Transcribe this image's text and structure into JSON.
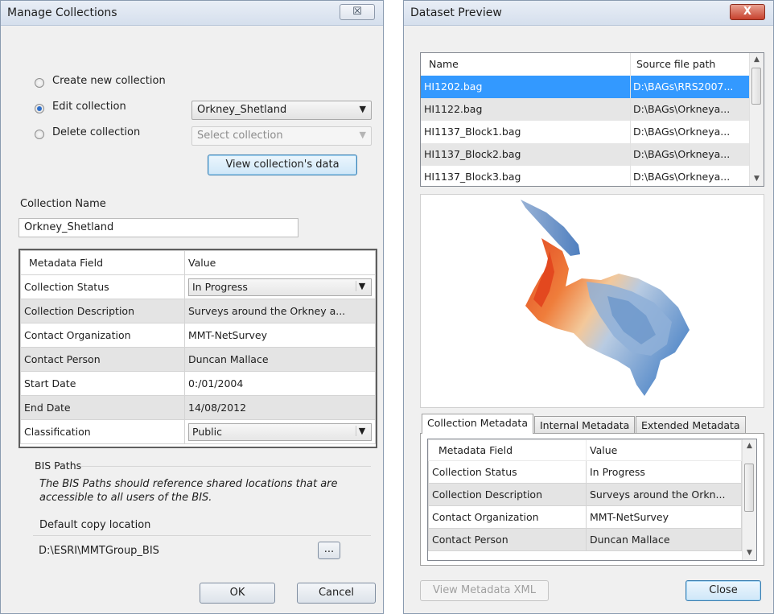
{
  "manage": {
    "title": "Manage Collections",
    "close_glyph": "☒",
    "options": [
      {
        "label": "Create new collection",
        "checked": false
      },
      {
        "label": "Edit collection",
        "checked": true
      },
      {
        "label": "Delete collection",
        "checked": false
      }
    ],
    "edit_combo_value": "Orkney_Shetland",
    "delete_combo_placeholder": "Select collection",
    "view_button": "View collection's data",
    "collection_name_label": "Collection Name",
    "collection_name_value": "Orkney_Shetland",
    "metadata_header": {
      "field": "Metadata Field",
      "value": "Value"
    },
    "metadata_rows": [
      {
        "field": "Collection Status",
        "value": "In Progress",
        "combo": true
      },
      {
        "field": "Collection Description",
        "value": "Surveys around the Orkney a...",
        "combo": false
      },
      {
        "field": "Contact Organization",
        "value": "MMT-NetSurvey",
        "combo": false
      },
      {
        "field": "Contact Person",
        "value": "Duncan Mallace",
        "combo": false
      },
      {
        "field": "Start Date",
        "value": "0:/01/2004",
        "combo": false
      },
      {
        "field": "End Date",
        "value": "14/08/2012",
        "combo": false
      },
      {
        "field": "Classification",
        "value": "Public",
        "combo": true
      }
    ],
    "bis_heading": "BIS Paths",
    "bis_note": "The BIS Paths should reference shared locations that are accessible to all users of the BIS.",
    "default_copy_label": "Default copy location",
    "default_copy_value": "D:\\ESRI\\MMTGroup_BIS",
    "browse_label": "...",
    "ok_label": "OK",
    "cancel_label": "Cancel"
  },
  "preview": {
    "title": "Dataset Preview",
    "close_glyph": "X",
    "file_columns": {
      "name": "Name",
      "path": "Source file path"
    },
    "files": [
      {
        "name": "HI1202.bag",
        "path": "D:\\BAGs\\RRS2007...",
        "selected": true
      },
      {
        "name": "HI1122.bag",
        "path": "D:\\BAGs\\Orkneya...",
        "selected": false
      },
      {
        "name": "HI1137_Block1.bag",
        "path": "D:\\BAGs\\Orkneya...",
        "selected": false
      },
      {
        "name": "HI1137_Block2.bag",
        "path": "D:\\BAGs\\Orkneya...",
        "selected": false
      },
      {
        "name": "HI1137_Block3.bag",
        "path": "D:\\BAGs\\Orkneya...",
        "selected": false
      }
    ],
    "tabs": [
      "Collection Metadata",
      "Internal Metadata",
      "Extended Metadata"
    ],
    "active_tab": 0,
    "metadata_header": {
      "field": "Metadata Field",
      "value": "Value"
    },
    "metadata_rows": [
      {
        "field": "Collection Status",
        "value": "In Progress"
      },
      {
        "field": "Collection Description",
        "value": "Surveys around the Orkn..."
      },
      {
        "field": "Contact Organization",
        "value": "MMT-NetSurvey"
      },
      {
        "field": "Contact Person",
        "value": "Duncan Mallace"
      }
    ],
    "view_xml_label": "View Metadata XML",
    "close_label": "Close"
  },
  "colors": {
    "selection": "#3399ff",
    "warm": "#e8542a",
    "cool": "#6f9fd3"
  }
}
